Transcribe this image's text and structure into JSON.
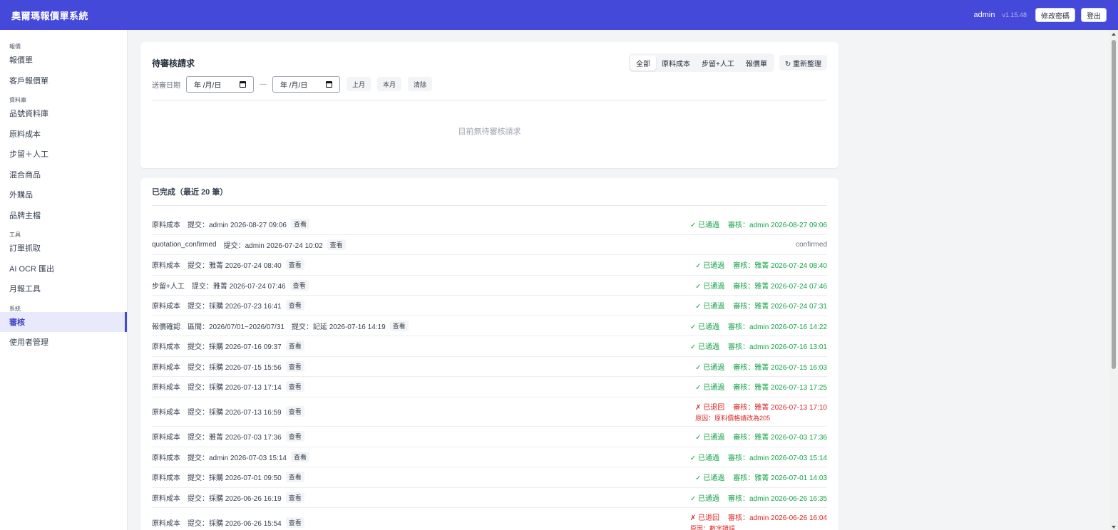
{
  "app": {
    "title": "奧爾瑪報價單系統",
    "user": "admin",
    "version": "v1.15.48",
    "change_password": "修改密碼",
    "logout": "登出"
  },
  "sidebar": {
    "groups": [
      {
        "label": "報價",
        "items": [
          "報價單",
          "客戶報價單"
        ]
      },
      {
        "label": "資料庫",
        "items": [
          "品號資料庫",
          "原料成本",
          "步留＋人工",
          "混合商品",
          "外購品",
          "品牌主檔"
        ]
      },
      {
        "label": "工具",
        "items": [
          "訂單抓取",
          "AI OCR 匯出",
          "月報工具"
        ]
      },
      {
        "label": "系統",
        "items": [
          "審核",
          "使用者管理"
        ]
      }
    ],
    "active": "審核"
  },
  "pending": {
    "title": "待審核請求",
    "filters": [
      "全部",
      "原料成本",
      "步留+人工",
      "報價單"
    ],
    "active_filter": "全部",
    "refresh": "↻ 重新整理",
    "date_label": "送審日期",
    "date_placeholder": "年 /月/日",
    "date_sep": "—",
    "btn_last_month": "上月",
    "btn_this_month": "本月",
    "btn_clear": "清除",
    "empty": "目前無待審核請求"
  },
  "completed": {
    "title": "已完成（最近 20 筆）",
    "view_label": "查看",
    "rows": [
      {
        "type": "原料成本",
        "submit": "提交：admin 2026-08-27 09:06",
        "kind": "approved",
        "status": "✓ 已通過",
        "review": "審核：admin 2026-08-27 09:06"
      },
      {
        "type": "quotation_confirmed",
        "submit": "提交：admin 2026-07-24 10:02",
        "kind": "plain",
        "status": "confirmed",
        "review": ""
      },
      {
        "type": "原料成本",
        "submit": "提交：雅菁 2026-07-24 08:40",
        "kind": "approved",
        "status": "✓ 已通過",
        "review": "審核：雅菁 2026-07-24 08:40"
      },
      {
        "type": "步留+人工",
        "submit": "提交：雅菁 2026-07-24 07:46",
        "kind": "approved",
        "status": "✓ 已通過",
        "review": "審核：雅菁 2026-07-24 07:46"
      },
      {
        "type": "原料成本",
        "submit": "提交：採購 2026-07-23 16:41",
        "kind": "approved",
        "status": "✓ 已通過",
        "review": "審核：雅菁 2026-07-24 07:31"
      },
      {
        "type": "報價確認",
        "period": "區間：2026/07/01~2026/07/31",
        "submit": "提交：記延 2026-07-16 14:19",
        "kind": "approved",
        "status": "✓ 已通過",
        "review": "審核：admin 2026-07-16 14:22"
      },
      {
        "type": "原料成本",
        "submit": "提交：採購 2026-07-16 09:37",
        "kind": "approved",
        "status": "✓ 已通過",
        "review": "審核：admin 2026-07-16 13:01"
      },
      {
        "type": "原料成本",
        "submit": "提交：採購 2026-07-15 15:56",
        "kind": "approved",
        "status": "✓ 已通過",
        "review": "審核：雅菁 2026-07-15 16:03"
      },
      {
        "type": "原料成本",
        "submit": "提交：採購 2026-07-13 17:14",
        "kind": "approved",
        "status": "✓ 已通過",
        "review": "審核：雅菁 2026-07-13 17:25"
      },
      {
        "type": "原料成本",
        "submit": "提交：採購 2026-07-13 16:59",
        "kind": "rejected",
        "status": "✗ 已退回",
        "review": "審核：雅菁 2026-07-13 17:10",
        "reason": "原因：原料價格請改為205"
      },
      {
        "type": "原料成本",
        "submit": "提交：雅菁 2026-07-03 17:36",
        "kind": "approved",
        "status": "✓ 已通過",
        "review": "審核：雅菁 2026-07-03 17:36"
      },
      {
        "type": "原料成本",
        "submit": "提交：admin 2026-07-03 15:14",
        "kind": "approved",
        "status": "✓ 已通過",
        "review": "審核：admin 2026-07-03 15:14"
      },
      {
        "type": "原料成本",
        "submit": "提交：採購 2026-07-01 09:50",
        "kind": "approved",
        "status": "✓ 已通過",
        "review": "審核：雅菁 2026-07-01 14:03"
      },
      {
        "type": "原料成本",
        "submit": "提交：採購 2026-06-26 16:19",
        "kind": "approved",
        "status": "✓ 已通過",
        "review": "審核：admin 2026-06-26 16:35"
      },
      {
        "type": "原料成本",
        "submit": "提交：採購 2026-06-26 15:54",
        "kind": "rejected",
        "status": "✗ 已退回",
        "review": "審核：admin 2026-06-26 16:04",
        "reason": "原因：數字錯誤"
      }
    ]
  }
}
